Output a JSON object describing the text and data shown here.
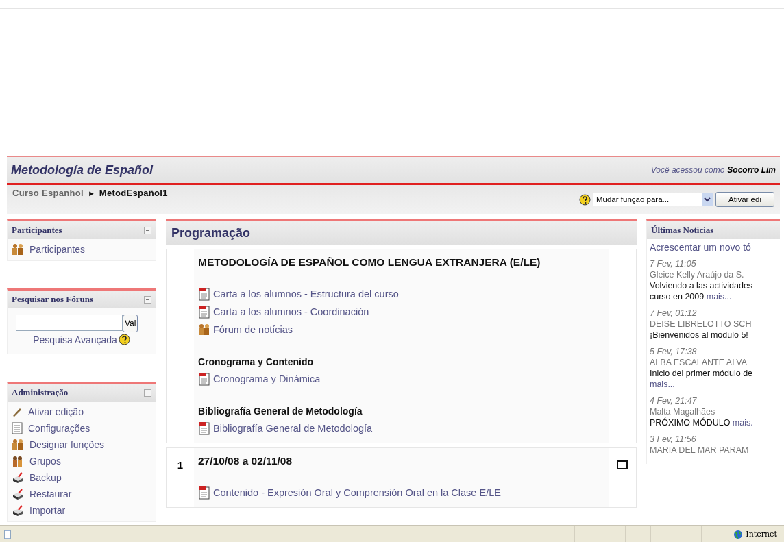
{
  "header": {
    "course_title": "Metodología de Español",
    "login_prefix": "Você acessou como",
    "login_user": "Socorro Lim"
  },
  "breadcrumb": {
    "items": [
      "Curso Espanhol",
      "MetodEspañol1"
    ],
    "separator": "►"
  },
  "nav_controls": {
    "role_select": "Mudar função para...",
    "edit_button": "Ativar edi"
  },
  "left_blocks": [
    {
      "title": "Participantes",
      "kind": "links",
      "items": [
        {
          "label": "Participantes",
          "kind": "people"
        }
      ]
    },
    {
      "title": "Pesquisar nos Fóruns",
      "kind": "search",
      "button": "Vai",
      "advanced": "Pesquisa Avançada"
    },
    {
      "title": "Administração",
      "kind": "links",
      "items": [
        {
          "label": "Ativar edição",
          "kind": "pen"
        },
        {
          "label": "Configurações",
          "kind": "doc"
        },
        {
          "label": "Designar funções",
          "kind": "people"
        },
        {
          "label": "Grupos",
          "kind": "group"
        },
        {
          "label": "Backup",
          "kind": "box"
        },
        {
          "label": "Restaurar",
          "kind": "box"
        },
        {
          "label": "Importar",
          "kind": "box"
        }
      ]
    }
  ],
  "main": {
    "title": "Programação",
    "sections": [
      {
        "title": "METODOLOGÍA DE ESPAÑOL COMO LENGUA EXTRANJERA (E/LE)",
        "marker": false,
        "items": [
          {
            "kind": "resource",
            "label": "Carta a los alumnos - Estructura del curso"
          },
          {
            "kind": "resource",
            "label": "Carta a los alumnos - Coordinación"
          },
          {
            "kind": "forum",
            "label": "Fórum de notícias"
          },
          {
            "kind": "heading",
            "label": "Cronograma y Contenido"
          },
          {
            "kind": "resource",
            "label": "Cronograma y Dinámica"
          },
          {
            "kind": "heading",
            "label": "Bibliografía General de Metodología"
          },
          {
            "kind": "resource",
            "label": "Bibliografía General de Metodología"
          }
        ]
      },
      {
        "number": "1",
        "title": "27/10/08 a 02/11/08",
        "marker": true,
        "items": [
          {
            "kind": "resource",
            "label": "Contenido - Expresión Oral y Comprensión Oral en la Clase E/LE"
          }
        ]
      }
    ]
  },
  "news": {
    "title": "Últimas Notícias",
    "add_link": "Acrescentar um novo tó",
    "posts": [
      {
        "date": "7 Fev, 11:05",
        "author": "Gleice Kelly Araújo da S.",
        "lines": [
          "Volviendo a las actividades",
          "curso en 2009"
        ],
        "more": "mais..."
      },
      {
        "date": "7 Fev, 01:12",
        "author": "DEISE LIBRELOTTO SCH",
        "lines": [
          "¡Bienvenidos al módulo 5!"
        ]
      },
      {
        "date": "5 Fev, 17:38",
        "author": "ALBA ESCALANTE ALVA",
        "lines": [
          "Inicio del primer módulo de"
        ],
        "more": "mais..."
      },
      {
        "date": "4 Fev, 21:47",
        "author": "Malta Magalhães",
        "lines": [
          "PRÓXIMO MÓDULO"
        ],
        "more": "mais."
      },
      {
        "date": "3 Fev, 11:56",
        "author": "MARIA DEL MAR PARAM"
      }
    ]
  },
  "status_bar": {
    "zone": "Internet"
  }
}
